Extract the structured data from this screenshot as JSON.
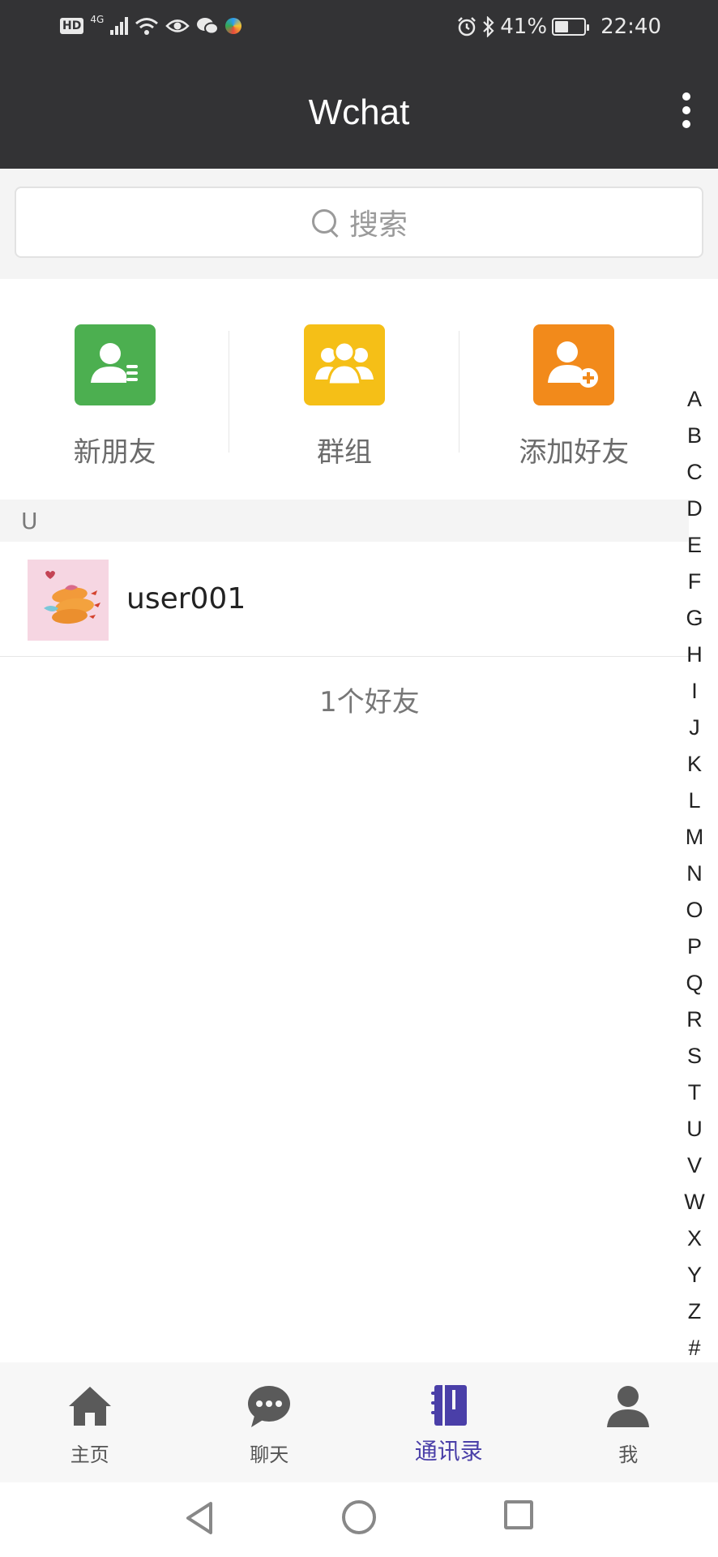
{
  "status_bar": {
    "hd": "HD",
    "network": "4G",
    "battery": "41%",
    "time": "22:40",
    "icons": [
      "hd-icon",
      "signal-icon",
      "wifi-icon",
      "eye-icon",
      "wechat-icon",
      "app-icon",
      "alarm-icon",
      "bluetooth-icon",
      "battery-icon"
    ]
  },
  "header": {
    "title": "Wchat",
    "menu_icon": "more-vertical-icon"
  },
  "search": {
    "placeholder": "搜索",
    "icon": "search-icon"
  },
  "quick_actions": [
    {
      "label": "新朋友",
      "icon": "new-friend-icon",
      "color": "#4caf50"
    },
    {
      "label": "群组",
      "icon": "group-icon",
      "color": "#f5bf17"
    },
    {
      "label": "添加好友",
      "icon": "add-friend-icon",
      "color": "#f28a1b"
    }
  ],
  "contacts": {
    "section_letter": "U",
    "items": [
      {
        "name": "user001",
        "avatar": "shrimp-tempura-avatar"
      }
    ],
    "footer": "1个好友"
  },
  "index_letters": [
    "A",
    "B",
    "C",
    "D",
    "E",
    "F",
    "G",
    "H",
    "I",
    "J",
    "K",
    "L",
    "M",
    "N",
    "O",
    "P",
    "Q",
    "R",
    "S",
    "T",
    "U",
    "V",
    "W",
    "X",
    "Y",
    "Z",
    "#"
  ],
  "bottom_nav": [
    {
      "label": "主页",
      "icon": "home-icon",
      "active": false
    },
    {
      "label": "聊天",
      "icon": "chat-icon",
      "active": false
    },
    {
      "label": "通讯录",
      "icon": "contacts-book-icon",
      "active": true
    },
    {
      "label": "我",
      "icon": "person-icon",
      "active": false
    }
  ],
  "colors": {
    "header_bg": "#333335",
    "accent": "#4a3fa8"
  }
}
